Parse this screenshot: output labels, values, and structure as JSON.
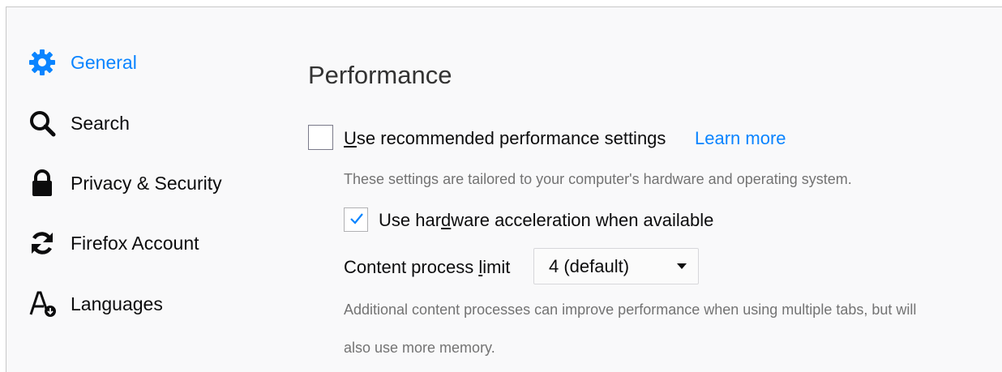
{
  "colors": {
    "accent": "#0a84ff",
    "text": "#0c0c0d",
    "muted": "#737373",
    "background": "#f9f9fa"
  },
  "sidebar": {
    "items": [
      {
        "label": "General",
        "icon": "gear-icon",
        "active": true
      },
      {
        "label": "Search",
        "icon": "search-icon",
        "active": false
      },
      {
        "label": "Privacy & Security",
        "icon": "lock-icon",
        "active": false
      },
      {
        "label": "Firefox Account",
        "icon": "sync-icon",
        "active": false
      },
      {
        "label": "Languages",
        "icon": "language-icon",
        "active": false
      }
    ]
  },
  "performance": {
    "title": "Performance",
    "recommended": {
      "label_pre": "U",
      "label_post": "se recommended performance settings",
      "checked": false,
      "learn_more": "Learn more",
      "description": "These settings are tailored to your computer's hardware and operating system."
    },
    "hw_accel": {
      "label_pre": "Use har",
      "label_accesskey": "d",
      "label_post": "ware acceleration when available",
      "checked": true
    },
    "content_process": {
      "label_pre": "Content process ",
      "label_accesskey": "l",
      "label_post": "imit",
      "selected": "4 (default)",
      "description_line1": "Additional content processes can improve performance when using multiple tabs, but will",
      "description_line2": "also use more memory."
    }
  }
}
